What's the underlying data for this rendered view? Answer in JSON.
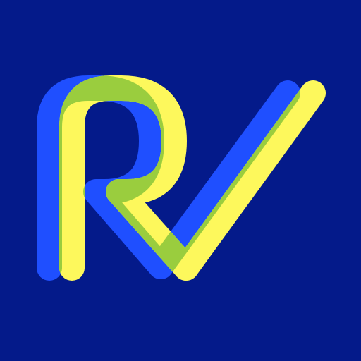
{
  "logo": {
    "name": "rv-monogram-logo",
    "letters": "RV",
    "colors": {
      "background": "#041a8a",
      "blue_stroke": "#1f4fff",
      "green_overlap": "#9acd3e",
      "yellow_stroke": "#fdf85c"
    }
  }
}
